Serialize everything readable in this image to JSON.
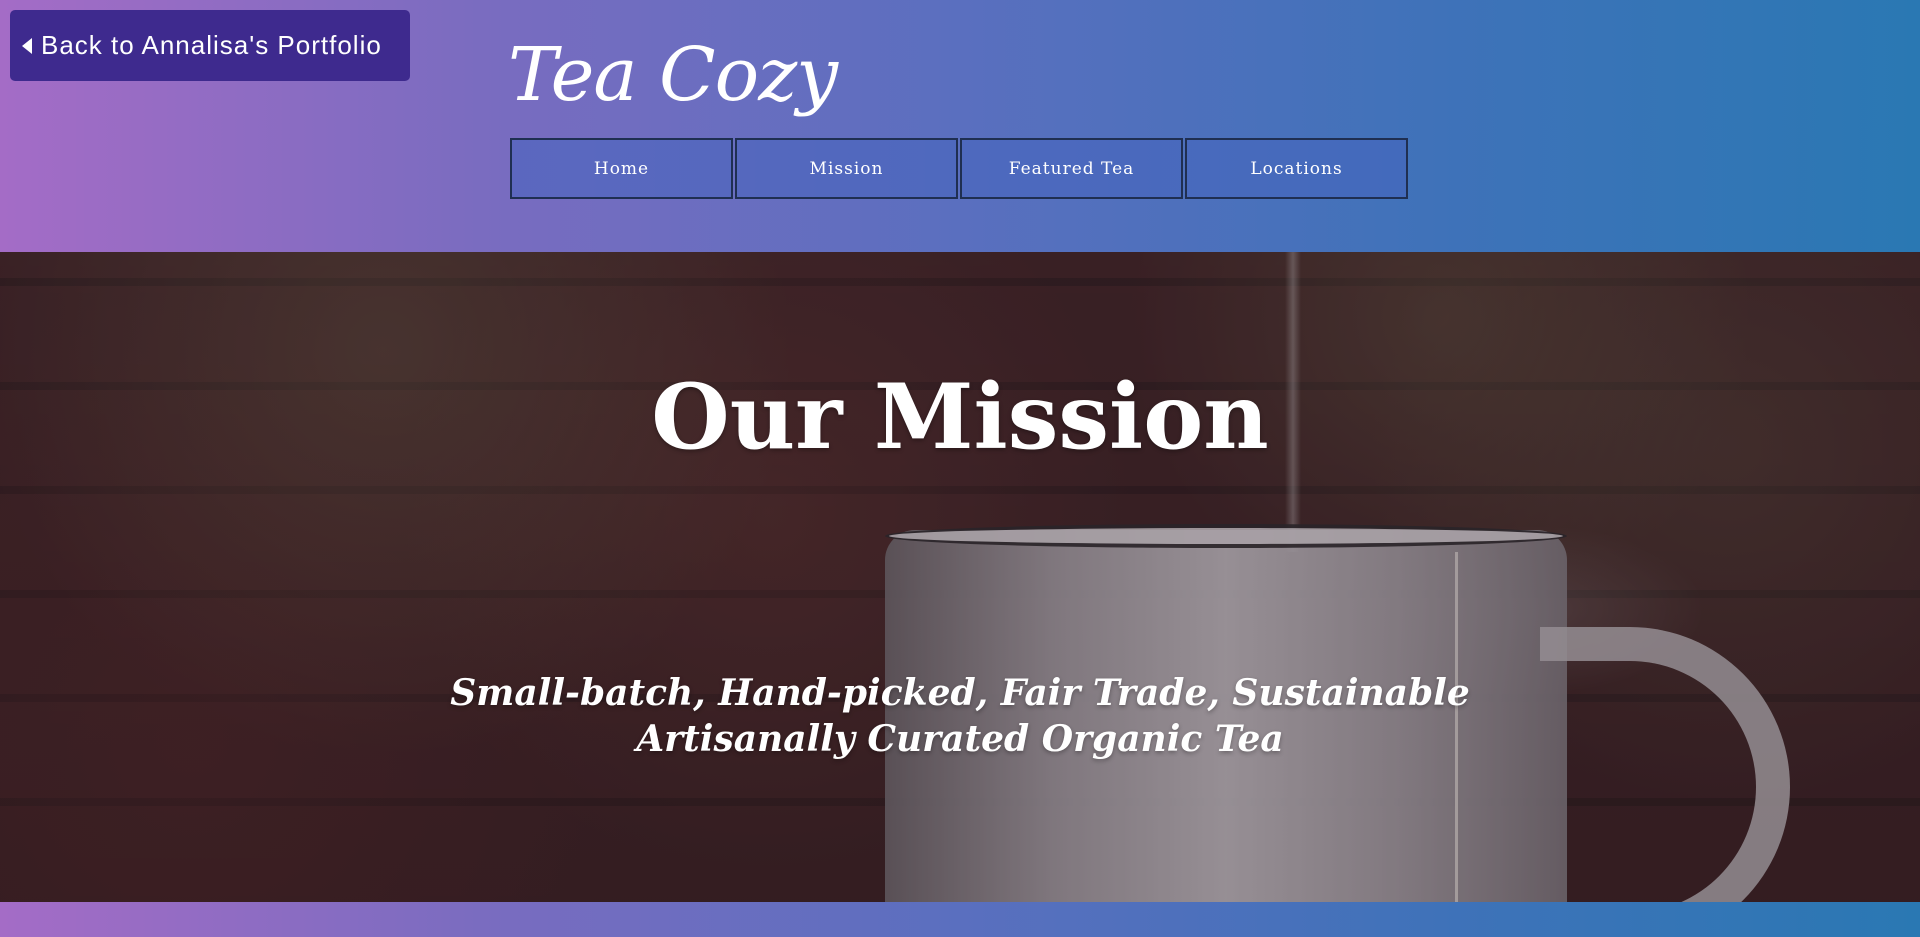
{
  "back_button": {
    "label": "Back to Annalisa's Portfolio",
    "icon": "caret-left-icon"
  },
  "logo": "Tea Cozy",
  "nav": {
    "items": [
      {
        "label": "Home"
      },
      {
        "label": "Mission"
      },
      {
        "label": "Featured Tea"
      },
      {
        "label": "Locations"
      }
    ]
  },
  "hero": {
    "title": "Our Mission",
    "subtitle": "Small-batch, Hand-picked, Fair Trade, Sustainable Artisanally Curated Organic Tea"
  },
  "colors": {
    "gradient_start": "#a46cc6",
    "gradient_end": "#2a78b3",
    "back_button_bg": "#3e2a8e",
    "nav_border": "#1f2f52"
  }
}
